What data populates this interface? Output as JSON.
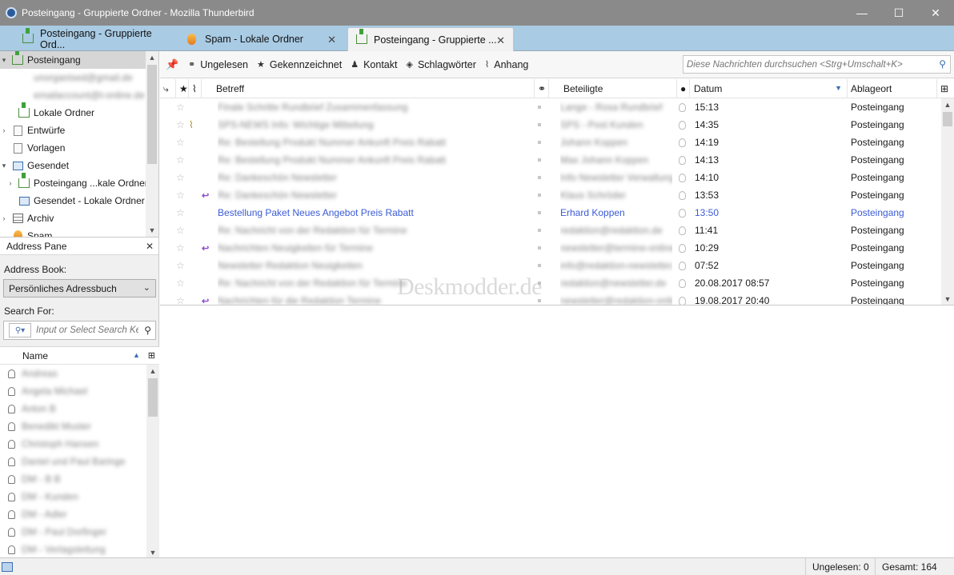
{
  "window": {
    "title": "Posteingang - Gruppierte Ordner - Mozilla Thunderbird",
    "minimize": "—",
    "maximize": "☐",
    "close": "✕"
  },
  "tabs": [
    {
      "label": "Posteingang - Gruppierte Ord...",
      "icon": "inbox-icon"
    },
    {
      "label": "Spam - Lokale Ordner",
      "icon": "flame-icon"
    },
    {
      "label": "Posteingang - Gruppierte ...",
      "icon": "inbox-icon"
    }
  ],
  "folders": [
    {
      "label": "Posteingang",
      "indent": 0,
      "twisty": "▾",
      "icon": "inbox-icon",
      "selected": true
    },
    {
      "label": "unorganised@gmail.de",
      "indent": 1,
      "twisty": "",
      "icon": "",
      "blurred": true
    },
    {
      "label": "emailaccount@t-online.de",
      "indent": 1,
      "twisty": "",
      "icon": "",
      "blurred": true
    },
    {
      "label": "Lokale Ordner",
      "indent": 1,
      "twisty": "",
      "icon": "inbox-icon"
    },
    {
      "label": "Entwürfe",
      "indent": 0,
      "twisty": "›",
      "icon": "document-icon"
    },
    {
      "label": "Vorlagen",
      "indent": 0,
      "twisty": "",
      "icon": "document-icon"
    },
    {
      "label": "Gesendet",
      "indent": 0,
      "twisty": "▾",
      "icon": "sent-icon"
    },
    {
      "label": "Posteingang ...kale Ordner",
      "indent": 1,
      "twisty": "›",
      "icon": "inbox-icon"
    },
    {
      "label": "Gesendet - Lokale Ordner",
      "indent": 1,
      "twisty": "",
      "icon": "sent-icon"
    },
    {
      "label": "Archiv",
      "indent": 0,
      "twisty": "›",
      "icon": "archive-icon"
    },
    {
      "label": "Spam",
      "indent": 0,
      "twisty": "",
      "icon": "flame-icon"
    }
  ],
  "address_pane": {
    "title": "Address Pane",
    "close": "✕",
    "address_book_label": "Address Book:",
    "address_book_value": "Persönliches Adressbuch",
    "search_label": "Search For:",
    "search_placeholder": "Input or Select Search Ke",
    "column_name": "Name",
    "contacts": [
      "Andreas",
      "Angela Michael",
      "Anton B",
      "Benedikt Muster",
      "Christoph Hansen",
      "Daniel und Paul Baringe",
      "DM - B B",
      "DM - Kunden",
      "DM - Adler",
      "DM - Paul Dorfinger",
      "DM - Verlagsleitung"
    ]
  },
  "toolbar": {
    "unread": "Ungelesen",
    "starred": "Gekennzeichnet",
    "contact": "Kontakt",
    "tags": "Schlagwörter",
    "attachment": "Anhang",
    "search_placeholder": "Diese Nachrichten durchsuchen <Strg+Umschalt+K>"
  },
  "columns": {
    "subject": "Betreff",
    "correspondents": "Beteiligte",
    "date": "Datum",
    "location": "Ablageort"
  },
  "messages": [
    {
      "subject": "Finale Schritte Rundbrief Zusammenfassung",
      "from": "Lange - Rosa Rundbrief",
      "date": "15:13",
      "location": "Posteingang",
      "attach": false,
      "replied": false,
      "highlight": false
    },
    {
      "subject": "SPS-NEWS Info: Wichtige Mitteilung",
      "from": "SPS - Post Kunden",
      "date": "14:35",
      "location": "Posteingang",
      "attach": true,
      "replied": false,
      "highlight": false
    },
    {
      "subject": "Re: Bestellung Produkt Nummer Ankunft Preis Rabatt",
      "from": "Johann Koppen",
      "date": "14:19",
      "location": "Posteingang",
      "attach": false,
      "replied": false,
      "highlight": false
    },
    {
      "subject": "Re: Bestellung Produkt Nummer Ankunft Preis Rabatt",
      "from": "Max Johann Koppen",
      "date": "14:13",
      "location": "Posteingang",
      "attach": false,
      "replied": false,
      "highlight": false
    },
    {
      "subject": "Re: Dankeschön Newsletter",
      "from": "Info Newsletter Verwaltung",
      "date": "14:10",
      "location": "Posteingang",
      "attach": false,
      "replied": false,
      "highlight": false
    },
    {
      "subject": "Re: Dankeschön Newsletter",
      "from": "Klaus Schröder",
      "date": "13:53",
      "location": "Posteingang",
      "attach": false,
      "replied": true,
      "highlight": false
    },
    {
      "subject": "Bestellung Paket Neues Angebot Preis Rabatt",
      "from": "Erhard Koppen",
      "date": "13:50",
      "location": "Posteingang",
      "attach": false,
      "replied": false,
      "highlight": true
    },
    {
      "subject": "Re: Nachricht von der Redaktion für Termine",
      "from": "redaktion@redaktion.de",
      "date": "11:41",
      "location": "Posteingang",
      "attach": false,
      "replied": false,
      "highlight": false
    },
    {
      "subject": "Nachrichten Neuigkeiten für Termine",
      "from": "newsletter@termine-online.de",
      "date": "10:29",
      "location": "Posteingang",
      "attach": false,
      "replied": true,
      "highlight": false
    },
    {
      "subject": "Newsletter Redaktion Neuigkeiten",
      "from": "info@redaktion-newsletter.de",
      "date": "07:52",
      "location": "Posteingang",
      "attach": false,
      "replied": false,
      "highlight": false
    },
    {
      "subject": "Re: Nachricht von der Redaktion für Termine",
      "from": "redaktion@newsletter.de",
      "date": "20.08.2017 08:57",
      "location": "Posteingang",
      "attach": false,
      "replied": false,
      "highlight": false
    },
    {
      "subject": "Nachrichten für die Redaktion Termine",
      "from": "newsletter@redaktion-online.de",
      "date": "19.08.2017 20:40",
      "location": "Posteingang",
      "attach": false,
      "replied": true,
      "highlight": false
    }
  ],
  "watermark": "Deskmodder.de",
  "status": {
    "unread": "Ungelesen: 0",
    "total": "Gesamt: 164"
  },
  "colors": {
    "titlebar": "#8a8a8a",
    "tabbar": "#a9cbe4",
    "highlight_text": "#3b5bd6",
    "reply": "#8a4bd0"
  }
}
